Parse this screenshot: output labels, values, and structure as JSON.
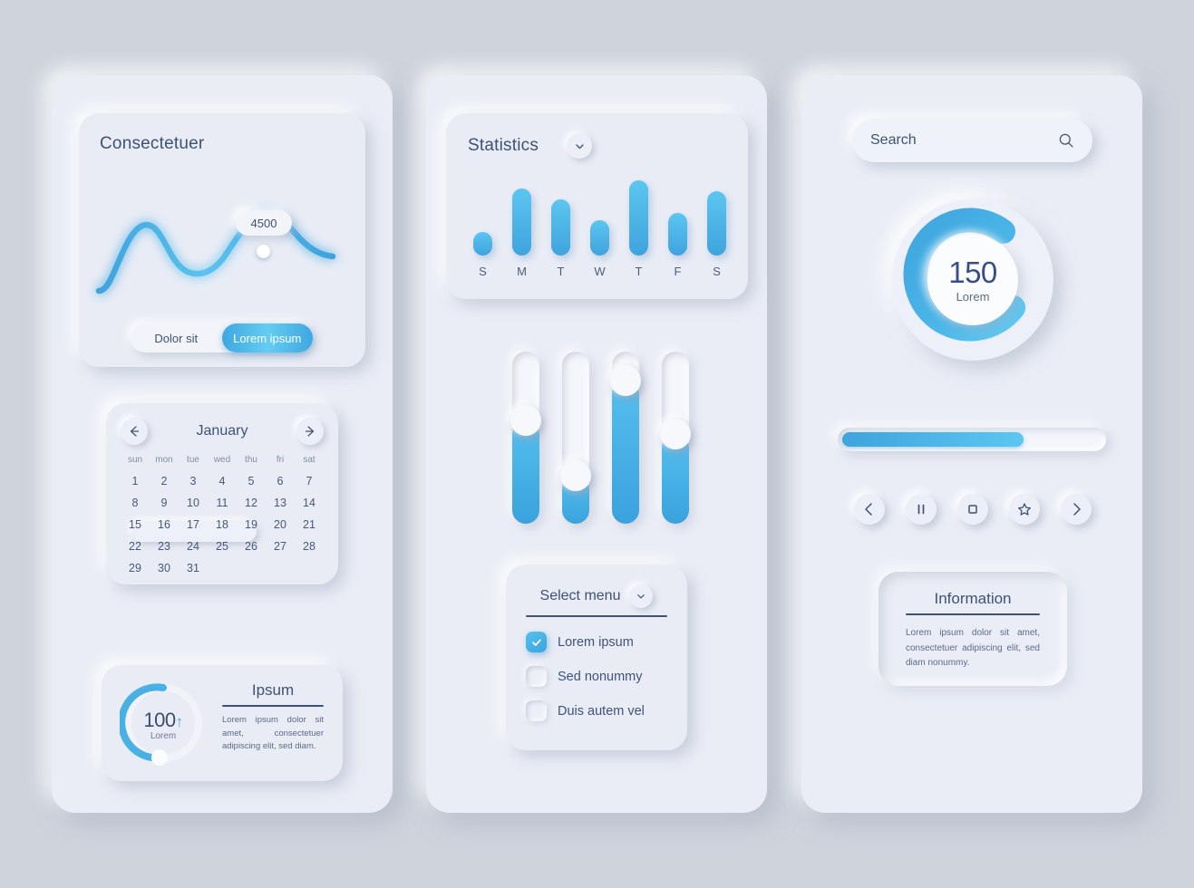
{
  "theme": {
    "page_background": "#ced3dc",
    "panel_background": "#eaedf6",
    "card_background": "#e9ecf5",
    "accent_blue": "#3fa7e0",
    "accent_blue_light": "#5cc7f1",
    "text_dark": "#3e5274",
    "text_muted": "#6d7c96"
  },
  "left_panel": {
    "chart": {
      "title": "Consectetuer",
      "tooltip_value": "4500",
      "toggle": {
        "option_inactive": "Dolor sit",
        "option_active": "Lorem ipsum"
      }
    },
    "calendar": {
      "month": "January",
      "prev_icon": "arrow-left-icon",
      "next_icon": "arrow-right-icon",
      "weekdays": [
        "sun",
        "mon",
        "tue",
        "wed",
        "thu",
        "fri",
        "sat"
      ],
      "days": [
        "1",
        "2",
        "3",
        "4",
        "5",
        "6",
        "7",
        "8",
        "9",
        "10",
        "11",
        "12",
        "13",
        "14",
        "15",
        "16",
        "17",
        "18",
        "19",
        "20",
        "21",
        "22",
        "23",
        "24",
        "25",
        "26",
        "27",
        "28",
        "29",
        "30",
        "31"
      ],
      "selected_range": [
        "16",
        "20"
      ]
    },
    "gauge_card": {
      "value": "100",
      "trend_icon": "arrow-up-icon",
      "unit_label": "Lorem",
      "title": "Ipsum",
      "body": "Lorem ipsum dolor sit amet, consectetuer adipiscing elit, sed diam."
    }
  },
  "center_panel": {
    "statistics": {
      "title": "Statistics",
      "chevron_icon": "chevron-down-icon"
    },
    "sliders": [
      {
        "name": "slider-1",
        "fill_percent": 60
      },
      {
        "name": "slider-2",
        "fill_percent": 28
      },
      {
        "name": "slider-3",
        "fill_percent": 83
      },
      {
        "name": "slider-4",
        "fill_percent": 52
      }
    ],
    "select_menu": {
      "label": "Select menu",
      "chevron_icon": "chevron-down-icon",
      "options": [
        {
          "label": "Lorem ipsum",
          "checked": true
        },
        {
          "label": "Sed nonummy",
          "checked": false
        },
        {
          "label": "Duis autem vel",
          "checked": false
        }
      ]
    }
  },
  "right_panel": {
    "search": {
      "placeholder": "Search",
      "value": "",
      "icon": "search-icon"
    },
    "donut": {
      "value": "150",
      "label": "Lorem",
      "percent": 83
    },
    "progress": {
      "percent": 70
    },
    "controls": [
      {
        "name": "previous-button",
        "icon": "chevron-left-icon",
        "glyph": "‹"
      },
      {
        "name": "pause-button",
        "icon": "pause-icon",
        "glyph": "‖"
      },
      {
        "name": "stop-button",
        "icon": "stop-icon",
        "glyph": "□"
      },
      {
        "name": "favorite-button",
        "icon": "star-icon",
        "glyph": "☆"
      },
      {
        "name": "next-button",
        "icon": "chevron-right-icon",
        "glyph": "›"
      }
    ],
    "information": {
      "title": "Information",
      "body": "Lorem ipsum dolor sit amet, consectetuer adipiscing elit, sed diam nonummy."
    }
  },
  "chart_data": [
    {
      "type": "line",
      "name": "consectetuer-line-chart",
      "title": "Consectetuer",
      "x": [
        0,
        1,
        2,
        3,
        4,
        5,
        6,
        7,
        8
      ],
      "values": [
        500,
        1200,
        3300,
        3400,
        2500,
        2300,
        3600,
        4500,
        3100
      ],
      "annotations": [
        {
          "x": 7,
          "y": 4500,
          "label": "4500"
        }
      ],
      "xlabel": "",
      "ylabel": "",
      "grid": false,
      "legend": "none"
    },
    {
      "type": "bar",
      "name": "statistics-bar-chart",
      "title": "Statistics",
      "categories": [
        "S",
        "M",
        "T",
        "W",
        "T",
        "F",
        "S"
      ],
      "values": [
        27,
        75,
        63,
        40,
        85,
        48,
        72
      ],
      "ylim": [
        0,
        100
      ],
      "xlabel": "",
      "ylabel": "",
      "grid": false,
      "legend": "none"
    },
    {
      "type": "pie",
      "name": "lorem-gauge-100",
      "title": "Ipsum",
      "categories": [
        "Lorem",
        "Remainder"
      ],
      "values": [
        53,
        47
      ],
      "center_value": "100",
      "center_label": "Lorem"
    },
    {
      "type": "pie",
      "name": "lorem-gauge-150",
      "categories": [
        "Lorem",
        "Remainder"
      ],
      "values": [
        83,
        17
      ],
      "center_value": "150",
      "center_label": "Lorem"
    }
  ]
}
